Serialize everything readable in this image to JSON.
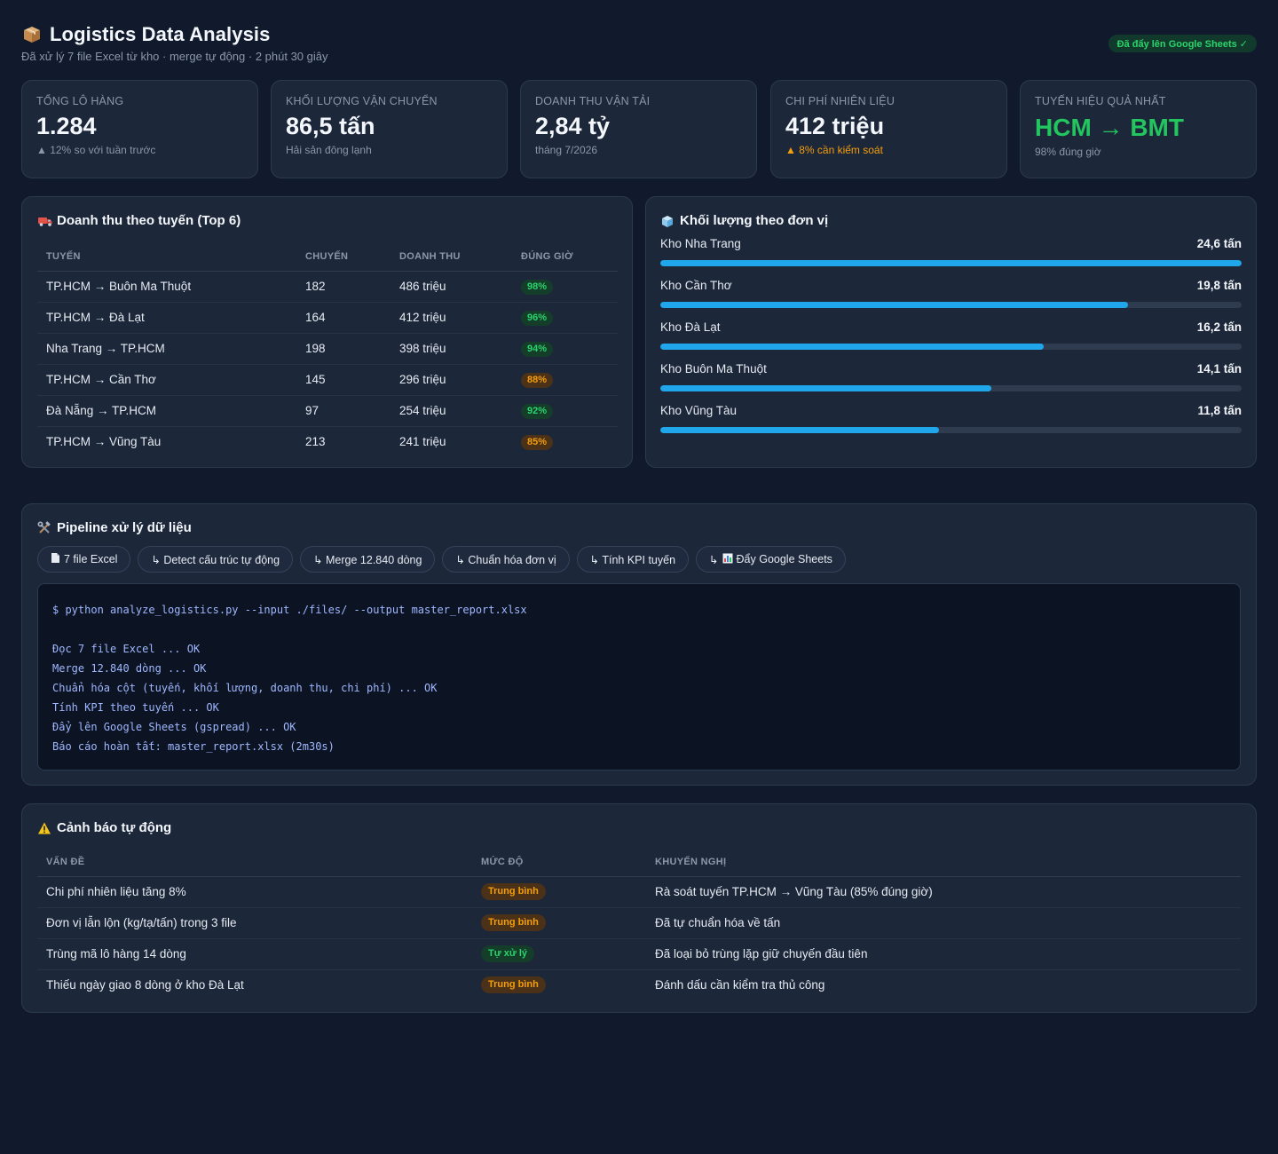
{
  "header": {
    "title": "Logistics Data Analysis",
    "subtitle": "Đã xử lý 7 file Excel từ kho · merge tự động · 2 phút 30 giây",
    "badge": "Đã đẩy lên Google Sheets ✓"
  },
  "kpis": [
    {
      "label": "Tổng lô hàng",
      "value": "1.284",
      "note": "▲ 12% so với tuần trước"
    },
    {
      "label": "Khối lượng vận chuyển",
      "value": "86,5 tấn",
      "note": "Hải sản đông lạnh"
    },
    {
      "label": "Doanh thu vận tải",
      "value": "2,84 tỷ",
      "note": "tháng 7/2026"
    },
    {
      "label": "Chi phí nhiên liệu",
      "value": "412 triệu",
      "note": "▲ 8% cần kiểm soát"
    },
    {
      "label": "Tuyến hiệu quả nhất",
      "value": "HCM → BMT",
      "note": "98% đúng giờ"
    }
  ],
  "routes": {
    "title": "Doanh thu theo tuyến (Top 6)",
    "columns": [
      "Tuyến",
      "Chuyến",
      "Doanh thu",
      "Đúng giờ"
    ],
    "rows": [
      {
        "route": "TP.HCM → Buôn Ma Thuột",
        "trips": "182",
        "revenue": "486 triệu",
        "ontime": "98%"
      },
      {
        "route": "TP.HCM → Đà Lạt",
        "trips": "164",
        "revenue": "412 triệu",
        "ontime": "96%"
      },
      {
        "route": "Nha Trang → TP.HCM",
        "trips": "198",
        "revenue": "398 triệu",
        "ontime": "94%"
      },
      {
        "route": "TP.HCM → Cần Thơ",
        "trips": "145",
        "revenue": "296 triệu",
        "ontime": "88%"
      },
      {
        "route": "Đà Nẵng → TP.HCM",
        "trips": "97",
        "revenue": "254 triệu",
        "ontime": "92%"
      },
      {
        "route": "TP.HCM → Vũng Tàu",
        "trips": "213",
        "revenue": "241 triệu",
        "ontime": "85%"
      }
    ]
  },
  "volume": {
    "title": "Khối lượng theo đơn vị",
    "items": [
      {
        "name": "Kho Nha Trang",
        "value": "24,6 tấn",
        "fraction": 1.0
      },
      {
        "name": "Kho Cần Thơ",
        "value": "19,8 tấn",
        "fraction": 0.805
      },
      {
        "name": "Kho Đà Lạt",
        "value": "16,2 tấn",
        "fraction": 0.659
      },
      {
        "name": "Kho Buôn Ma Thuột",
        "value": "14,1 tấn",
        "fraction": 0.569
      },
      {
        "name": "Kho Vũng Tàu",
        "value": "11,8 tấn",
        "fraction": 0.479
      }
    ]
  },
  "pipeline": {
    "title": "Pipeline xử lý dữ liệu",
    "steps": [
      {
        "label": "7 file Excel",
        "icon": "document-icon"
      },
      {
        "label": "↳ Detect cấu trúc tự động"
      },
      {
        "label": "↳ Merge 12.840 dòng"
      },
      {
        "label": "↳ Chuẩn hóa đơn vị"
      },
      {
        "label": "↳ Tính KPI tuyến"
      },
      {
        "label": "↳",
        "label2": "Đẩy Google Sheets",
        "icon": "chart-icon"
      }
    ],
    "terminal": [
      "$ python analyze_logistics.py --input ./files/ --output master_report.xlsx",
      "",
      "Đọc 7 file Excel ... OK",
      "Merge 12.840 dòng ... OK",
      "Chuẩn hóa cột (tuyến, khối lượng, doanh thu, chi phí) ... OK",
      "Tính KPI theo tuyến ... OK",
      "Đẩy lên Google Sheets (gspread) ... OK",
      "Báo cáo hoàn tất: master_report.xlsx (2m30s)"
    ]
  },
  "alerts": {
    "title": "Cảnh báo tự động",
    "columns": [
      "Vấn đề",
      "Mức độ",
      "Khuyến nghị"
    ],
    "rows": [
      {
        "issue": "Chi phí nhiên liệu tăng 8%",
        "level": "Trung bình",
        "level_kind": "mid",
        "advice": "Rà soát tuyến TP.HCM → Vũng Tàu (85% đúng giờ)"
      },
      {
        "issue": "Đơn vị lẫn lộn (kg/tạ/tấn) trong 3 file",
        "level": "Trung bình",
        "level_kind": "mid",
        "advice": "Đã tự chuẩn hóa về tấn"
      },
      {
        "issue": "Trùng mã lô hàng 14 dòng",
        "level": "Tự xử lý",
        "level_kind": "auto",
        "advice": "Đã loại bỏ trùng lặp giữ chuyến đầu tiên"
      },
      {
        "issue": "Thiếu ngày giao 8 dòng ở kho Đà Lạt",
        "level": "Trung bình",
        "level_kind": "mid",
        "advice": "Đánh dấu cần kiểm tra thủ công"
      }
    ]
  },
  "colors": {
    "background": "#111a2c",
    "card": "#1c273a",
    "accent_bar": "#20a6ea",
    "good": "#22c55e",
    "warn": "#f59e0b"
  }
}
